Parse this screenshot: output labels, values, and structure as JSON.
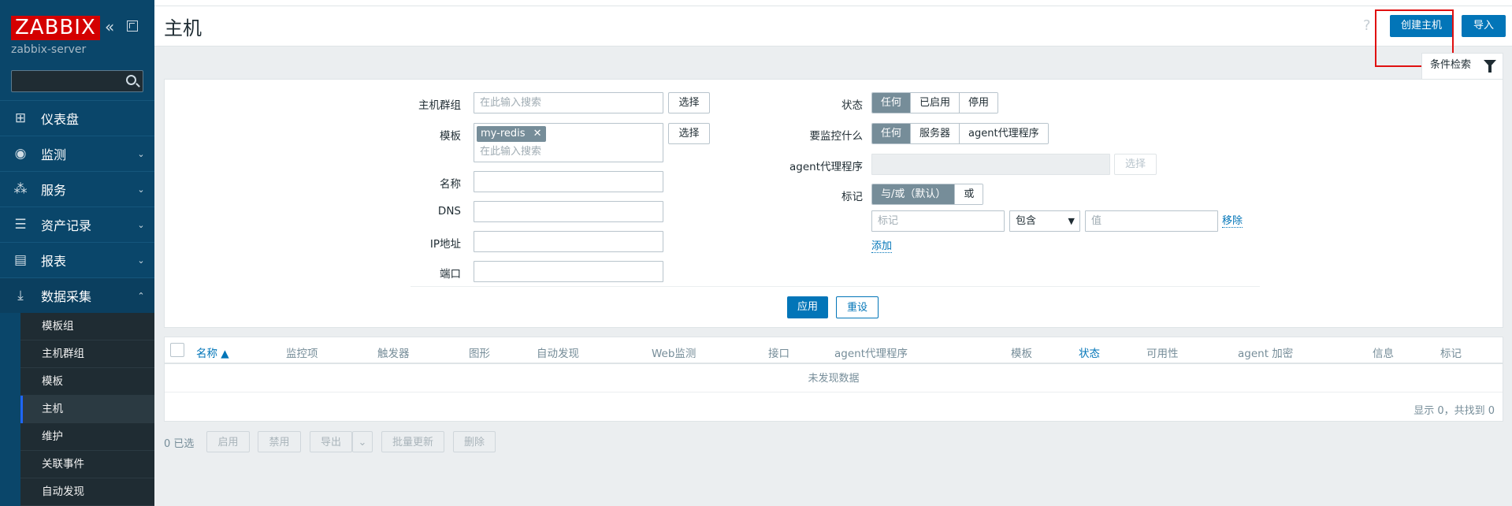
{
  "sidebar": {
    "logo": "ZABBIX",
    "server_name": "zabbix-server",
    "search_value": "",
    "nav": [
      {
        "label": "仪表盘",
        "icon": "dashboard-icon"
      },
      {
        "label": "监测",
        "icon": "eye-icon"
      },
      {
        "label": "服务",
        "icon": "hierarchy-icon"
      },
      {
        "label": "资产记录",
        "icon": "list-icon"
      },
      {
        "label": "报表",
        "icon": "report-icon"
      },
      {
        "label": "数据采集",
        "icon": "download-icon"
      }
    ],
    "submenu": [
      "模板组",
      "主机群组",
      "模板",
      "主机",
      "维护",
      "关联事件",
      "自动发现"
    ]
  },
  "header": {
    "title": "主机",
    "help": "?",
    "create_host": "创建主机",
    "import": "导入"
  },
  "filter": {
    "tab_label": "条件检索",
    "host_groups_label": "主机群组",
    "host_groups_placeholder": "在此输入搜索",
    "select": "选择",
    "templates_label": "模板",
    "template_chip": "my-redis",
    "chip_remove": "✕",
    "templates_placeholder": "在此输入搜索",
    "name_label": "名称",
    "dns_label": "DNS",
    "ip_label": "IP地址",
    "port_label": "端口",
    "status_label": "状态",
    "status_options": [
      "任何",
      "已启用",
      "停用"
    ],
    "monitored_by_label": "要监控什么",
    "monitored_by_options": [
      "任何",
      "服务器",
      "agent代理程序"
    ],
    "proxy_label": "agent代理程序",
    "proxy_select": "选择",
    "tags_label": "标记",
    "tags_options": [
      "与/或（默认）",
      "或"
    ],
    "tag_placeholder": "标记",
    "tag_operator": "包含",
    "value_placeholder": "值",
    "remove": "移除",
    "add": "添加",
    "apply": "应用",
    "reset": "重设"
  },
  "table": {
    "columns": [
      "名称 ▲",
      "监控项",
      "触发器",
      "图形",
      "自动发现",
      "Web监测",
      "接口",
      "agent代理程序",
      "模板",
      "状态",
      "可用性",
      "agent 加密",
      "信息",
      "标记"
    ],
    "no_data": "未发现数据",
    "count": "显示 0，共找到 0"
  },
  "actions": {
    "selected": "0 已选",
    "enable": "启用",
    "disable": "禁用",
    "export": "导出",
    "mass_update": "批量更新",
    "delete": "删除"
  }
}
